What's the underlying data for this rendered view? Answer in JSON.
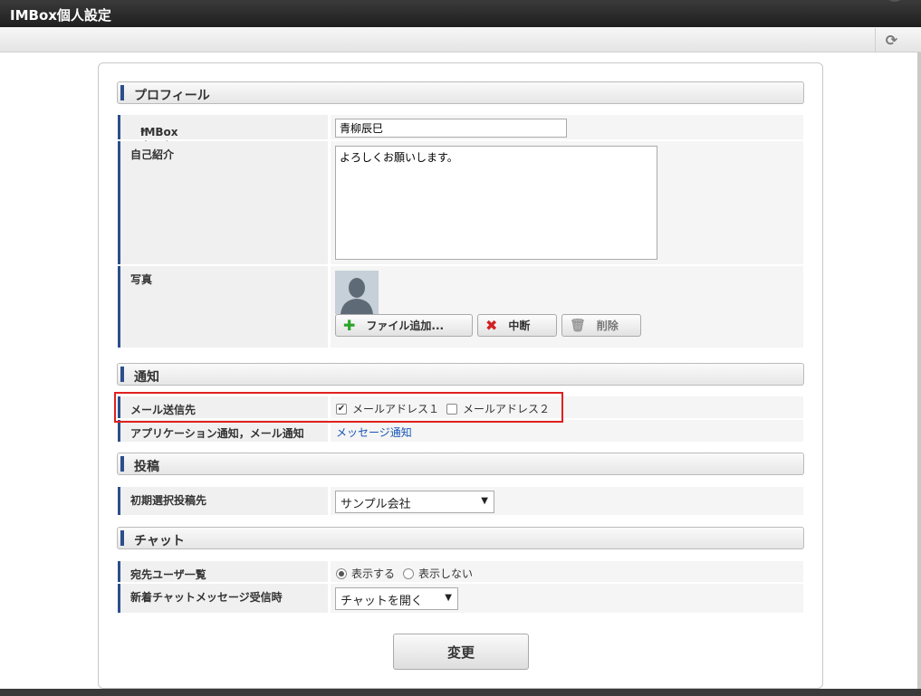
{
  "window": {
    "title": "IMBox個人設定"
  },
  "toolbar": {
    "refresh_icon": "refresh-icon"
  },
  "sections": {
    "profile": "プロフィール",
    "notification": "通知",
    "post": "投稿",
    "chat": "チャット"
  },
  "profile": {
    "display_name_label": "IMBox表示名",
    "required_mark": "*",
    "display_name_value": "青柳辰巳",
    "intro_label": "自己紹介",
    "intro_value": "よろしくお願いします。",
    "photo_label": "写真",
    "add_file_label": "ファイル追加...",
    "cancel_label": "中断",
    "delete_label": "削除"
  },
  "notification": {
    "mail_dest_label": "メール送信先",
    "mail1_label": "メールアドレス１",
    "mail1_checked": true,
    "mail2_label": "メールアドレス２",
    "mail2_checked": false,
    "app_notify_label": "アプリケーション通知，メール通知",
    "app_notify_link": "メッセージ通知"
  },
  "post": {
    "default_target_label": "初期選択投稿先",
    "default_target_value": "サンプル会社"
  },
  "chat": {
    "recipients_label": "宛先ユーザ一覧",
    "show_label": "表示する",
    "hide_label": "表示しない",
    "selected": "show",
    "new_message_label": "新着チャットメッセージ受信時",
    "new_message_value": "チャットを開く"
  },
  "actions": {
    "submit_label": "変更"
  }
}
